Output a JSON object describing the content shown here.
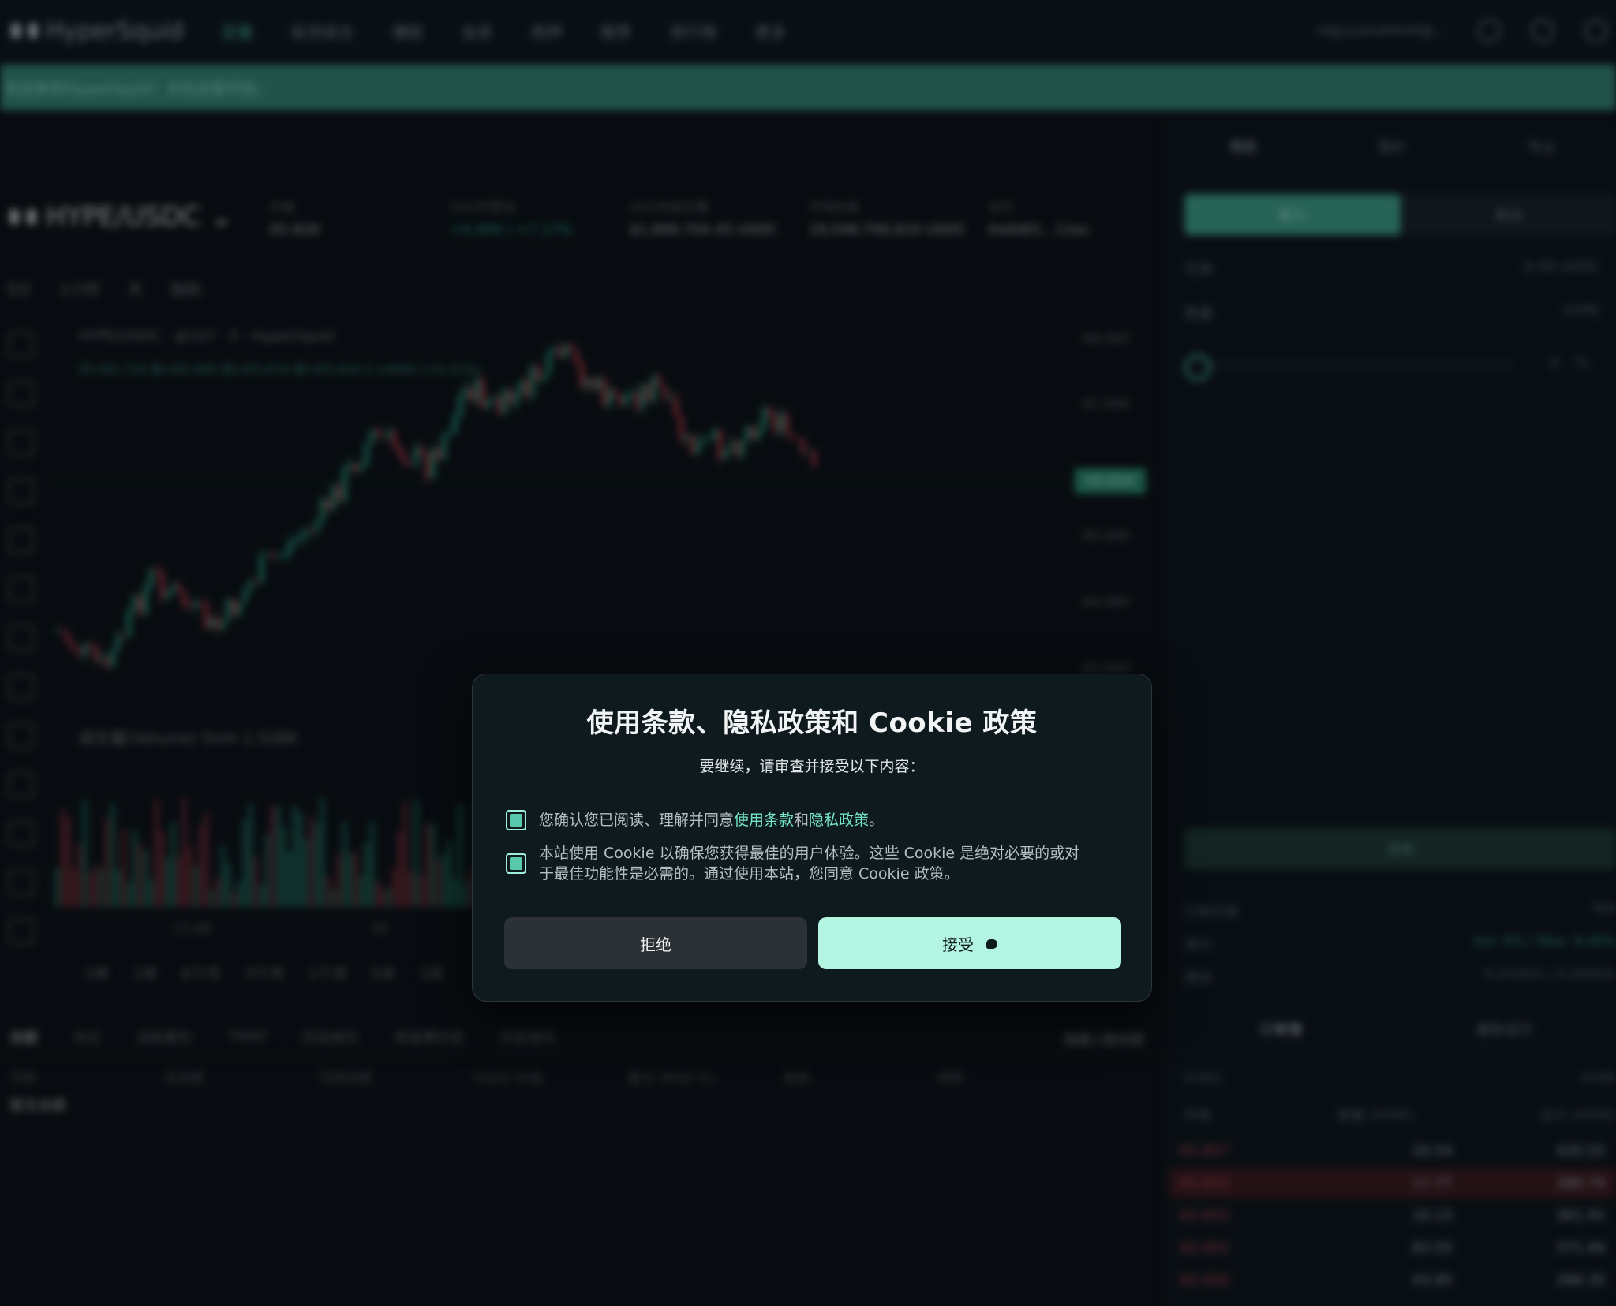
{
  "nav": {
    "brand": "HyperSquid",
    "items": [
      "交易",
      "投资组合",
      "赚取",
      "金库",
      "质押",
      "推荐",
      "排行榜",
      "更多"
    ],
    "wallet": "r4quvanxlhhhf@..."
  },
  "banner": {
    "text": "欢迎来到Hyperliquid！点击这里开始。"
  },
  "ticker": {
    "pair": "HYPE/USDC",
    "stats": [
      {
        "label": "价格",
        "value": "65.828"
      },
      {
        "label": "24小时变化",
        "value": "+4.404 / +7.17%"
      },
      {
        "label": "24小时成交量",
        "value": "$1,899,704.45 USDC"
      },
      {
        "label": "市场总值",
        "value": "19,548,700,810 USDC"
      },
      {
        "label": "合约",
        "value": "0x0d01...11ec"
      }
    ]
  },
  "chart_toolbar": [
    "5分",
    "1小时",
    "天",
    "指标"
  ],
  "chart": {
    "title": "HYPE/USDC · @107 · 5 · HyperSquid",
    "ohlc": "开=65.718 高=65.860 低=65.674 收=65.834 5.14000 (+0.21%)",
    "volume_label": "成交量(Volume) 5mh 1.526K",
    "axis": [
      "68.000",
      "67.000",
      "66.000",
      "65.000",
      "64.000",
      "63.000"
    ],
    "last_price": "65.834",
    "time_labels": [
      "21:00",
      "20"
    ],
    "ranges": [
      "5年",
      "1年",
      "6个月",
      "3个月",
      "1个月",
      "5天",
      "1天"
    ]
  },
  "bottom_tabs": [
    "余额",
    "仓位",
    "当前委托",
    "TWAP",
    "历史成交",
    "资金费历史",
    "历史委托"
  ],
  "hide_small": "隐藏小额余额",
  "table_head": [
    "币种",
    "总余额",
    "可用余额",
    "USDC 价值",
    "盈亏 (ROE %)",
    "发送",
    "转账",
    "还款",
    "合约"
  ],
  "no_balance": "暂无余额",
  "right_panel": {
    "order_tabs": [
      "市价",
      "限价",
      "专业"
    ],
    "buy": "买入",
    "sell": "卖出",
    "available_label": "可用",
    "available_value": "0.00 USDC",
    "size_label": "数量",
    "size_unit": "HYPE",
    "slider_value": "0",
    "slider_unit": "%",
    "submit": "连接",
    "order_value_label": "订单价值",
    "order_value": "N/A",
    "slippage_label": "滑点",
    "slippage_value": "Est: 0% / Max: 8.00%",
    "fee_label": "费用",
    "fee_value": "0.0700% / 0.0400%",
    "book_tabs": [
      "订单簿",
      "最新成交"
    ],
    "book_tick": "0.001",
    "book_unit": "HYPE",
    "book_head": [
      "价格",
      "数量 (HYPE)",
      "总计 (HYPE)"
    ],
    "asks": [
      {
        "price": "65.857",
        "size": "20.54",
        "total": "420.55"
      },
      {
        "price": "65.855",
        "size": "17.77",
        "total": "388.74"
      },
      {
        "price": "65.853",
        "size": "10.13",
        "total": "361.91"
      },
      {
        "price": "65.852",
        "size": "83.55",
        "total": "371.84"
      },
      {
        "price": "65.850",
        "size": "43.85",
        "total": "288.35"
      }
    ]
  },
  "modal": {
    "title": "使用条款、隐私政策和 Cookie 政策",
    "subtitle": "要继续，请审查并接受以下内容：",
    "consent1_pre": "您确认您已阅读、理解并同意",
    "consent1_terms": "使用条款",
    "consent1_and": "和",
    "consent1_privacy": "隐私政策",
    "consent1_end": "。",
    "consent2_line1": "本站使用 Cookie 以确保您获得最佳的用户体验。这些 Cookie 是绝对必要的或对",
    "consent2_line2": "于最佳功能性是必需的。通过使用本站，您同意 Cookie 政策。",
    "reject": "拒绝",
    "accept": "接受"
  },
  "colors": {
    "accent": "#b4f5e2",
    "link": "#74e6c8",
    "up": "#2ea88a",
    "down": "#c0424e",
    "banner": "#37867a"
  },
  "icons": [
    "hyperliquid-logo-icon",
    "chevron-down-icon",
    "chat-icon",
    "globe-icon",
    "settings-icon",
    "cursor-pointer-icon"
  ]
}
